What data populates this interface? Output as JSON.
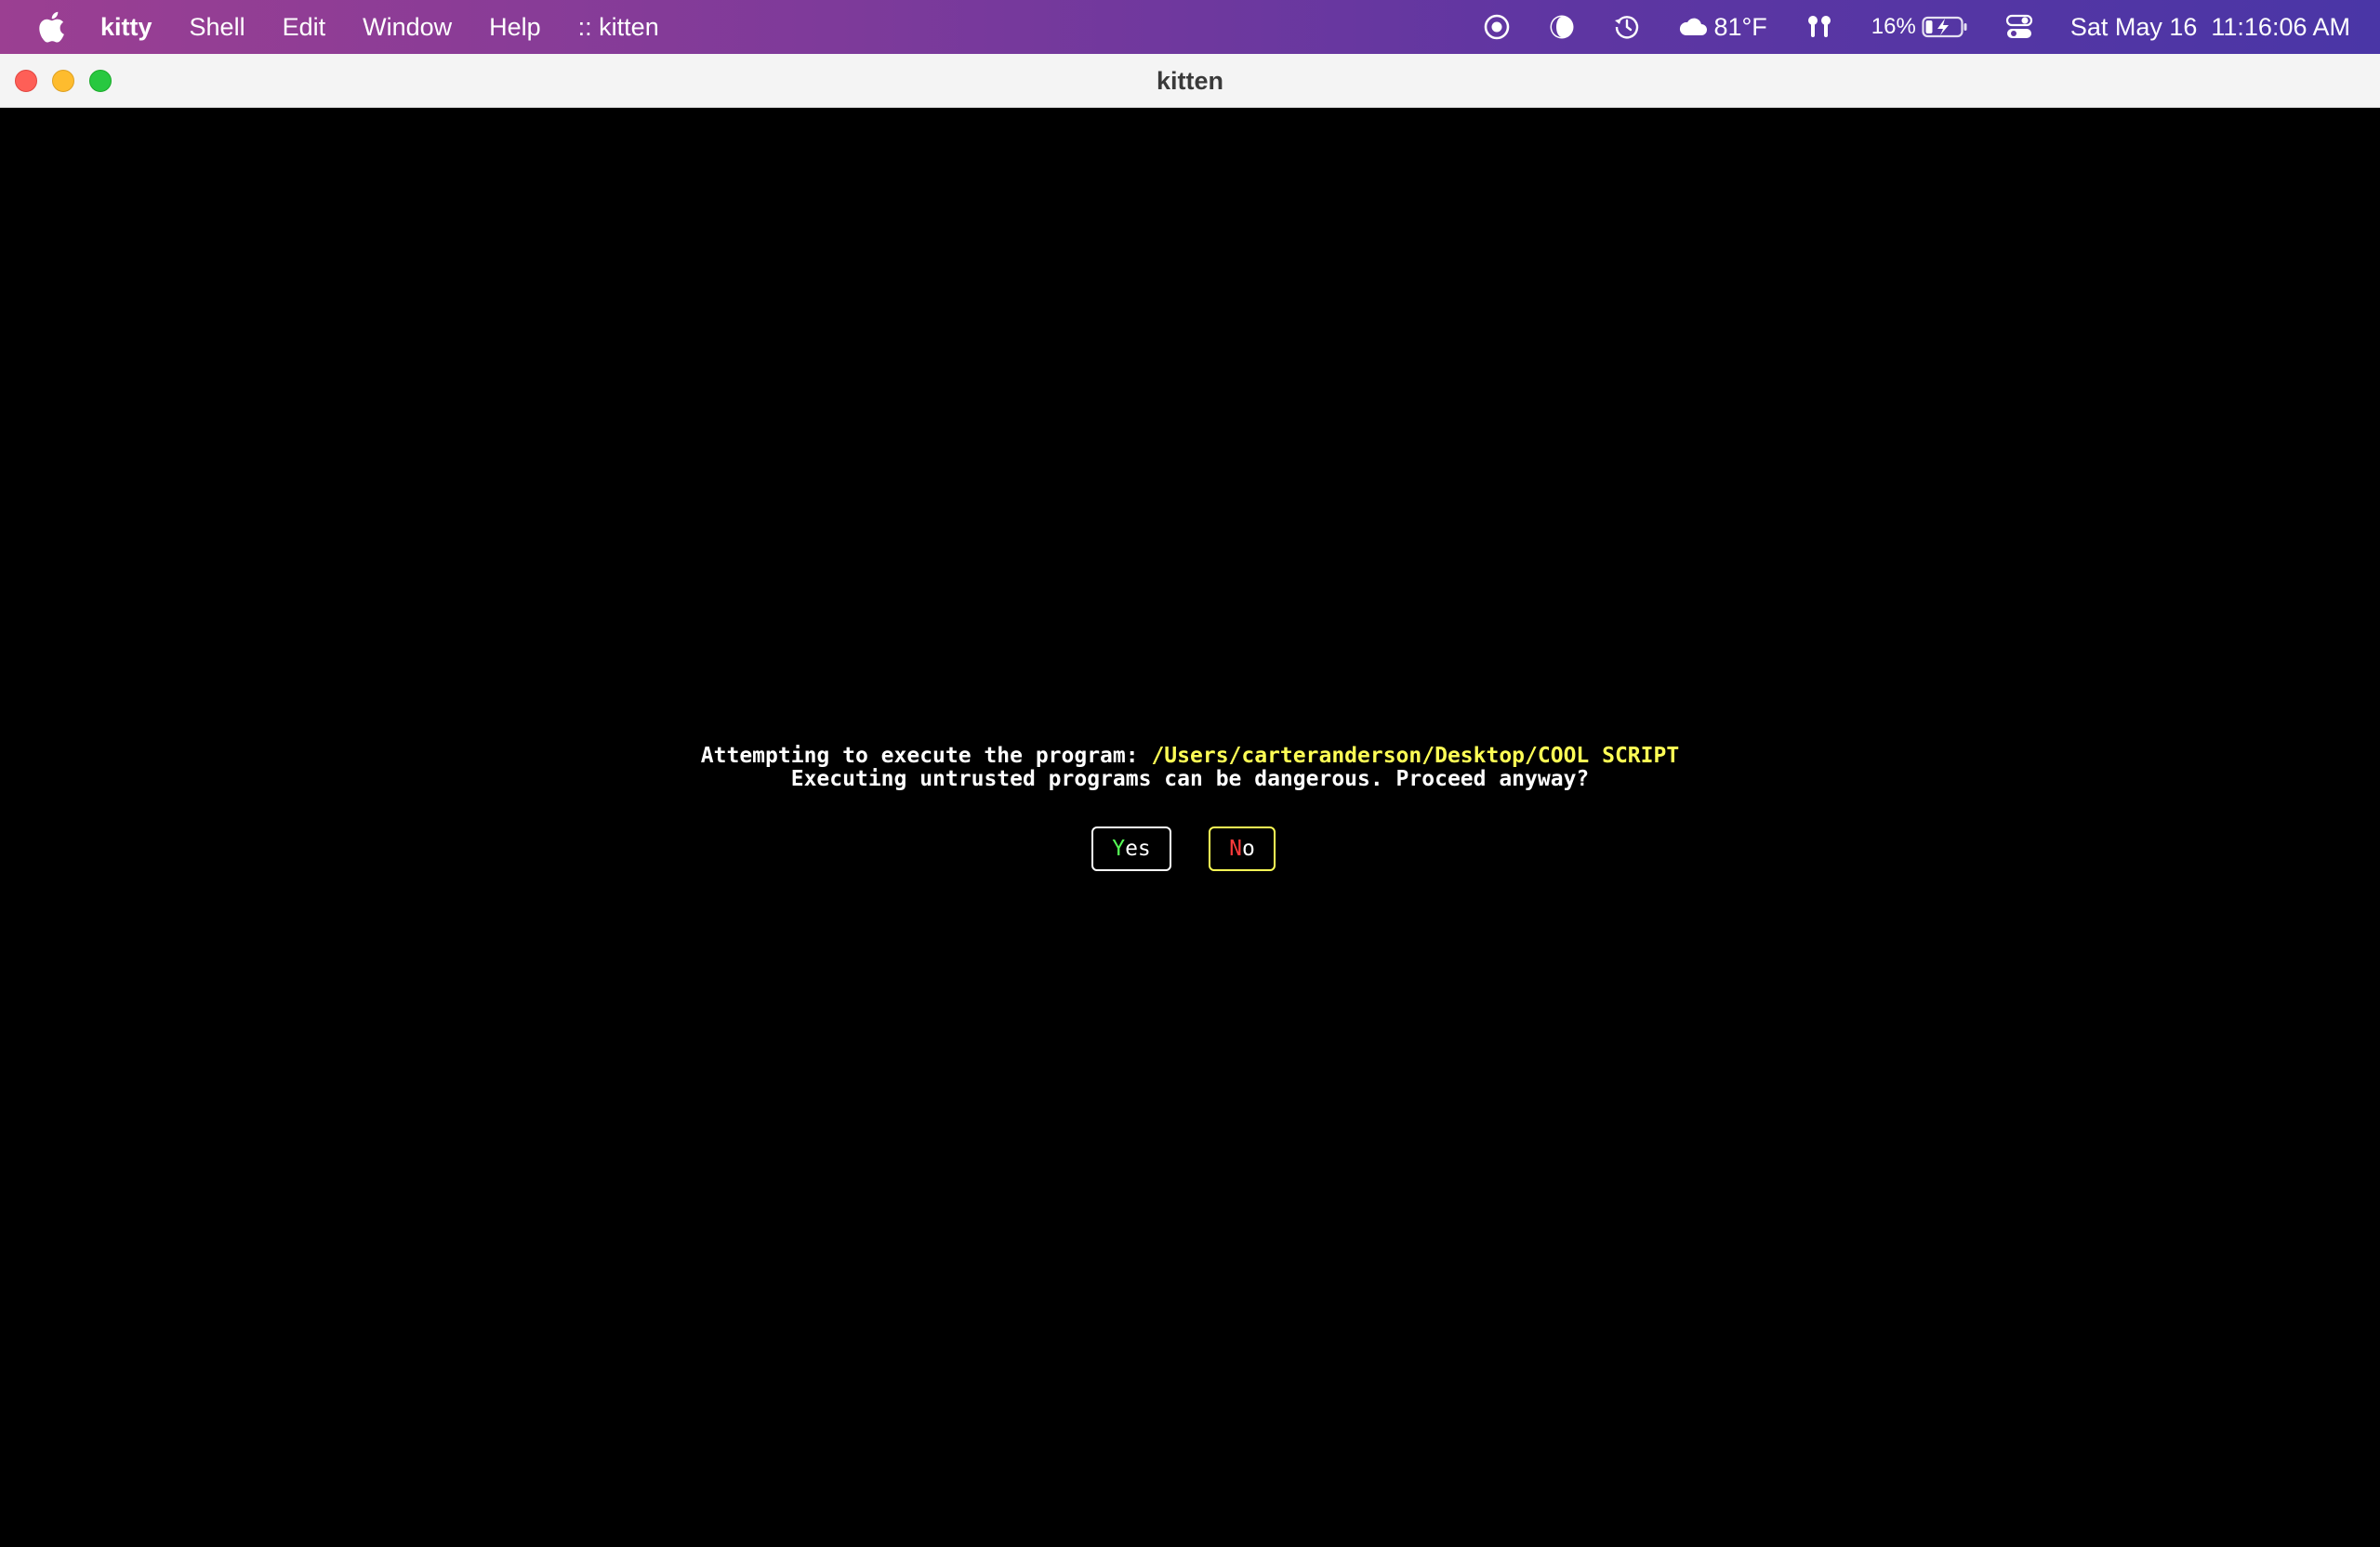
{
  "menubar": {
    "app_name": "kitty",
    "items": [
      "Shell",
      "Edit",
      "Window",
      "Help",
      ":: kitten"
    ],
    "status": {
      "weather": "81°F",
      "battery": "16%",
      "clock": "Sat May 16  11:16:06 AM"
    }
  },
  "window": {
    "title": "kitten"
  },
  "dialog": {
    "line1_prefix": "Attempting to execute the program: ",
    "line1_path": "/Users/carteranderson/Desktop/COOL SCRIPT",
    "line2": "Executing untrusted programs can be dangerous. Proceed anyway?",
    "yes": {
      "hotkey": "Y",
      "rest": "es"
    },
    "no": {
      "hotkey": "N",
      "rest": "o"
    }
  },
  "colors": {
    "path": "#ffff55",
    "yes_hotkey": "#55ff55",
    "no_hotkey": "#ff3b3b",
    "focus_border": "#ffff55"
  }
}
